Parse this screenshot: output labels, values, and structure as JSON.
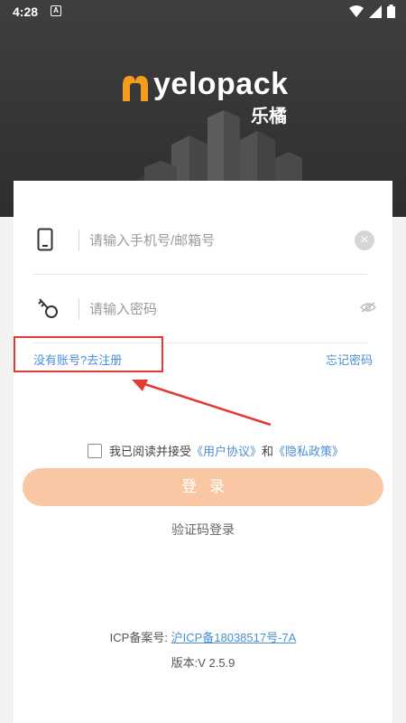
{
  "status_bar": {
    "time": "4:28",
    "notification_badge": "A"
  },
  "brand": {
    "name": "yelopack",
    "subtitle": "乐橘",
    "accent_color": "#f39c1e"
  },
  "phone_field": {
    "placeholder": "请输入手机号/邮箱号",
    "icon": "phone-icon"
  },
  "password_field": {
    "placeholder": "请输入密码",
    "icon": "key-icon"
  },
  "links": {
    "register": "没有账号?去注册",
    "forgot": "忘记密码"
  },
  "agreement": {
    "prefix": "我已阅读并接受",
    "user_agreement": "《用户协议》",
    "and": "和",
    "privacy_policy": "《隐私政策》"
  },
  "login_button": "登录",
  "code_login": "验证码登录",
  "footer": {
    "icp_label": "ICP备案号:",
    "icp_number": "沪ICP备18038517号-7A",
    "version": "版本:V 2.5.9"
  },
  "colors": {
    "link": "#4a8fd6",
    "button": "#f9c7a3",
    "highlight": "#e23b36"
  }
}
